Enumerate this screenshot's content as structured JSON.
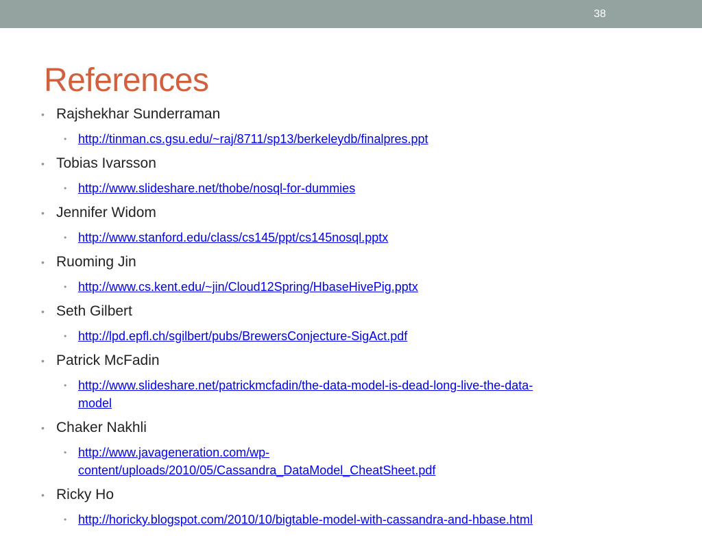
{
  "slide": {
    "number": "38",
    "title": "References",
    "references": [
      {
        "name": "Rajshekhar Sunderraman",
        "link": "http://tinman.cs.gsu.edu/~raj/8711/sp13/berkeleydb/finalpres.ppt"
      },
      {
        "name": "Tobias Ivarsson",
        "link": "http://www.slideshare.net/thobe/nosql-for-dummies"
      },
      {
        "name": "Jennifer Widom",
        "link": "http://www.stanford.edu/class/cs145/ppt/cs145nosql.pptx"
      },
      {
        "name": "Ruoming Jin",
        "link": "http://www.cs.kent.edu/~jin/Cloud12Spring/HbaseHivePig.pptx"
      },
      {
        "name": "Seth Gilbert",
        "link": "http://lpd.epfl.ch/sgilbert/pubs/BrewersConjecture-SigAct.pdf"
      },
      {
        "name": "Patrick McFadin",
        "link_line1": "http://www.slideshare.net/patrickmcfadin/the-data-model-is-dead-long-live-the-data-",
        "link_line2": "model"
      },
      {
        "name": "Chaker Nakhli",
        "link_line1": "http://www.javageneration.com/wp-",
        "link_line2": "content/uploads/2010/05/Cassandra_DataModel_CheatSheet.pdf"
      },
      {
        "name": "Ricky Ho",
        "link": "http://horicky.blogspot.com/2010/10/bigtable-model-with-cassandra-and-hbase.html"
      }
    ],
    "colors": {
      "top_bar": "#95a3a0",
      "title": "#d0603e",
      "link": "#0000ee",
      "text": "#222222",
      "bullet": "#8a9a97"
    }
  }
}
